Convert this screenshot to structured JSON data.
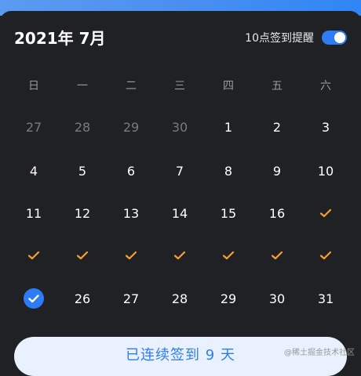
{
  "header": {
    "month_title": "2021年 7月",
    "reminder_label": "10点签到提醒",
    "reminder_enabled": true
  },
  "weekdays": [
    "日",
    "一",
    "二",
    "三",
    "四",
    "五",
    "六"
  ],
  "weeks": [
    [
      {
        "t": "27",
        "s": "muted"
      },
      {
        "t": "28",
        "s": "muted"
      },
      {
        "t": "29",
        "s": "muted"
      },
      {
        "t": "30",
        "s": "muted"
      },
      {
        "t": "1",
        "s": "normal"
      },
      {
        "t": "2",
        "s": "normal"
      },
      {
        "t": "3",
        "s": "normal"
      }
    ],
    [
      {
        "t": "4",
        "s": "normal"
      },
      {
        "t": "5",
        "s": "normal"
      },
      {
        "t": "6",
        "s": "normal"
      },
      {
        "t": "7",
        "s": "normal"
      },
      {
        "t": "8",
        "s": "normal"
      },
      {
        "t": "9",
        "s": "normal"
      },
      {
        "t": "10",
        "s": "normal"
      }
    ],
    [
      {
        "t": "11",
        "s": "normal"
      },
      {
        "t": "12",
        "s": "normal"
      },
      {
        "t": "13",
        "s": "normal"
      },
      {
        "t": "14",
        "s": "normal"
      },
      {
        "t": "15",
        "s": "normal"
      },
      {
        "t": "16",
        "s": "normal"
      },
      {
        "t": "",
        "s": "checked"
      }
    ],
    [
      {
        "t": "",
        "s": "checked"
      },
      {
        "t": "",
        "s": "checked"
      },
      {
        "t": "",
        "s": "checked"
      },
      {
        "t": "",
        "s": "checked"
      },
      {
        "t": "",
        "s": "checked"
      },
      {
        "t": "",
        "s": "checked"
      },
      {
        "t": "",
        "s": "checked"
      }
    ],
    [
      {
        "t": "",
        "s": "today"
      },
      {
        "t": "26",
        "s": "normal"
      },
      {
        "t": "27",
        "s": "normal"
      },
      {
        "t": "28",
        "s": "normal"
      },
      {
        "t": "29",
        "s": "normal"
      },
      {
        "t": "30",
        "s": "normal"
      },
      {
        "t": "31",
        "s": "normal"
      }
    ]
  ],
  "streak_button": {
    "label": "已连续签到 9 天"
  },
  "watermark": "@稀土掘金技术社区",
  "colors": {
    "accent": "#2d7cf6",
    "check": "#f5a030",
    "background": "#202124",
    "muted_text": "#7b7b7b"
  }
}
